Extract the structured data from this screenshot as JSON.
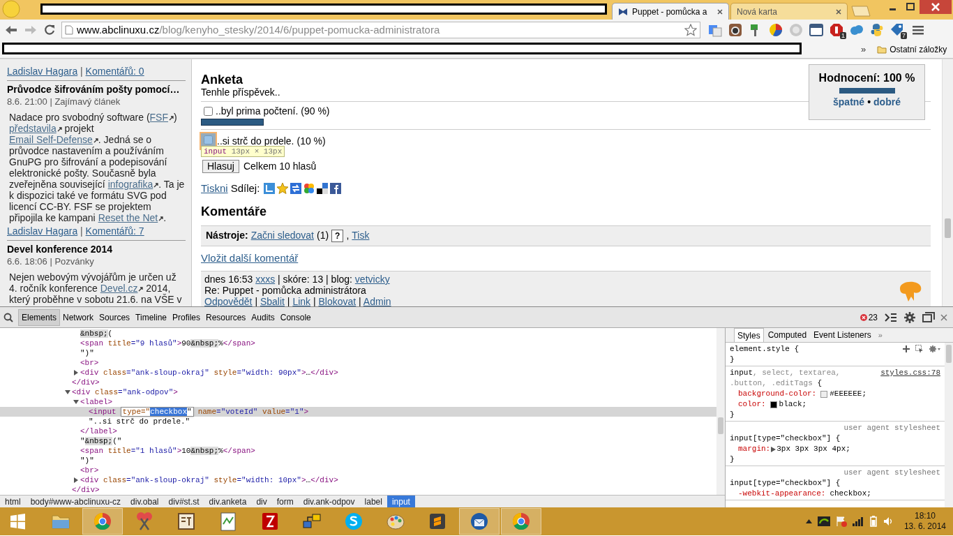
{
  "browser": {
    "tabs": [
      {
        "title": "Puppet - pomůcka a",
        "selected": true
      },
      {
        "title": "Nová karta",
        "selected": false
      }
    ],
    "url": {
      "host": "www.abclinuxu.cz",
      "path": "/blog/kenyho_stesky/2014/6/puppet-pomucka-administratora"
    },
    "extensions": [
      {
        "kind": "translate"
      },
      {
        "kind": "camera"
      },
      {
        "kind": "pin"
      },
      {
        "kind": "pie"
      },
      {
        "kind": "globe"
      },
      {
        "kind": "window"
      },
      {
        "kind": "stop",
        "badge": "1"
      },
      {
        "kind": "cloud"
      },
      {
        "kind": "python"
      },
      {
        "kind": "tag",
        "badge": "7"
      }
    ],
    "bookmarks": {
      "overflow": "»",
      "folder": "Ostatní záložky"
    }
  },
  "sidebar": {
    "top_footer": [
      {
        "text": "Ladislav Hagara",
        "link": true,
        "external": false
      },
      {
        "text": " | ",
        "link": false
      },
      {
        "text": "Komentářů: 0",
        "link": true,
        "external": false
      }
    ],
    "articles": [
      {
        "title": "Průvodce šifrováním pošty pomocí…",
        "meta": "8.6. 21:00 | Zajímavý článek",
        "body": [
          {
            "text": "Nadace pro svobodný software (",
            "link": false
          },
          {
            "text": "FSF",
            "link": true,
            "external": true
          },
          {
            "text": ") ",
            "link": false
          },
          {
            "text": "představila",
            "link": true,
            "external": true
          },
          {
            "text": " projekt ",
            "link": false
          },
          {
            "text": "Email Self-Defense",
            "link": true,
            "external": true
          },
          {
            "text": ". Jedná se o průvodce nastavením a používáním GnuPG pro šifrování a podepisování elektronické pošty. Současně byla zveřejněna související ",
            "link": false
          },
          {
            "text": "infografika",
            "link": true,
            "external": true
          },
          {
            "text": ". Ta je k dispozici také ve formátu SVG pod licencí CC-BY. FSF se projektem připojila ke kampani ",
            "link": false
          },
          {
            "text": "Reset the Net",
            "link": true,
            "external": true
          },
          {
            "text": ".",
            "link": false
          }
        ],
        "footer": [
          {
            "text": "Ladislav Hagara",
            "link": true,
            "external": false
          },
          {
            "text": " | ",
            "link": false
          },
          {
            "text": "Komentářů: 7",
            "link": true,
            "external": false
          }
        ]
      },
      {
        "title": "Devel konference 2014",
        "meta": "6.6. 18:06 | Pozvánky",
        "body": [
          {
            "text": "Nejen webovým vývojářům je určen už 4. ročník konference ",
            "link": false
          },
          {
            "text": "Devel.cz",
            "link": true,
            "external": true
          },
          {
            "text": " 2014, který proběhne v sobotu 21.6. na VŠE v",
            "link": false
          }
        ]
      }
    ]
  },
  "rating": {
    "title": "Hodnocení: 100 %",
    "level": 1,
    "bad": "špatné",
    "dot": "•",
    "good": "dobré"
  },
  "poll": {
    "title": "Anketa",
    "question": "Tenhle příspěvek..",
    "options": [
      {
        "label": "..byl prima počtení.",
        "percent": "(90 %)",
        "checked": false,
        "inspected": false,
        "level": 0.9
      },
      {
        "label": "..si strč do prdele.",
        "percent": "(10 %)",
        "checked": false,
        "inspected": true
      }
    ],
    "tooltip": {
      "tag": "input",
      "size": "13px × 13px"
    },
    "vote_button": "Hlasuj",
    "total": "Celkem 10 hlasů"
  },
  "share": {
    "print": "Tiskni",
    "label": "Sdílej:",
    "services": [
      {
        "kind": "arrow"
      },
      {
        "kind": "star"
      },
      {
        "kind": "swap"
      },
      {
        "kind": "google"
      },
      {
        "kind": "delicious"
      },
      {
        "kind": "facebook"
      }
    ]
  },
  "comments": {
    "title": "Komentáře",
    "tools_label": "Nástroje:",
    "follow": "Začni sledovat",
    "follow_count": "(1)",
    "help": "?",
    "comma": ",",
    "print": "Tisk",
    "add": "Vložit další komentář",
    "items": [
      {
        "meta": [
          {
            "text": "dnes 16:53 ",
            "link": false
          },
          {
            "text": "xxxs",
            "link": true,
            "external": false
          },
          {
            "text": " | skóre: 13 | blog: ",
            "link": false
          },
          {
            "text": "vetvicky",
            "link": true,
            "external": false
          }
        ],
        "subject": "Re: Puppet - pomůcka administrátora",
        "actions": [
          {
            "text": "Odpovědět",
            "link": true,
            "external": false
          },
          {
            "text": " | ",
            "link": false
          },
          {
            "text": "Sbalit",
            "link": true,
            "external": false
          },
          {
            "text": " | ",
            "link": false
          },
          {
            "text": "Link",
            "link": true,
            "external": false
          },
          {
            "text": " | ",
            "link": false
          },
          {
            "text": "Blokovat",
            "link": true,
            "external": false
          },
          {
            "text": " | ",
            "link": false
          },
          {
            "text": "Admin",
            "link": true,
            "external": false
          }
        ]
      }
    ]
  },
  "devtools": {
    "panels": [
      {
        "label": "Elements",
        "selected": true
      },
      {
        "label": "Network",
        "selected": false
      },
      {
        "label": "Sources",
        "selected": false
      },
      {
        "label": "Timeline",
        "selected": false
      },
      {
        "label": "Profiles",
        "selected": false
      },
      {
        "label": "Resources",
        "selected": false
      },
      {
        "label": "Audits",
        "selected": false
      },
      {
        "label": "Console",
        "selected": false
      }
    ],
    "errors": "23",
    "dom": [
      {
        "closing": "</div>",
        "children": [
          {
            "markup": "&nbsp;("
          },
          {
            "markup": "<span title=\"9 hlasů\">90&nbsp;%</span>"
          },
          {
            "markup": "\")\""
          },
          {
            "markup": "<br>"
          },
          {
            "markup": "<div class=\"ank-sloup-okraj\" style=\"width: 90px\">…</div>",
            "expanded": false
          }
        ]
      },
      {
        "markup": "<div class=\"ank-odpov\">",
        "expanded": true,
        "closing": "</div>",
        "children": [
          {
            "markup": "<label>",
            "expanded": true,
            "closing": "</label>",
            "children": [
              {
                "markup": "<input",
                "selected": true,
                "editor": {
                  "before": "type=\"",
                  "value": "checkbox",
                  "after": "\""
                },
                "after": "name=\"voteId\" value=\"1\">"
              },
              {
                "markup": "\"..si strč do prdele.\""
              }
            ]
          },
          {
            "markup": "\"&nbsp;(\""
          },
          {
            "markup": "<span title=\"1 hlasů\">10&nbsp;%</span>"
          },
          {
            "markup": "\")\""
          },
          {
            "markup": "<br>"
          },
          {
            "markup": "<div class=\"ank-sloup-okraj\" style=\"width: 10px\">…</div>",
            "expanded": false
          }
        ]
      }
    ],
    "breadcrumbs": [
      {
        "label": "html",
        "selected": false
      },
      {
        "label": "body#www-abclinuxu-cz",
        "selected": false
      },
      {
        "label": "div.obal",
        "selected": false
      },
      {
        "label": "div#st.st",
        "selected": false
      },
      {
        "label": "div.anketa",
        "selected": false
      },
      {
        "label": "div",
        "selected": false
      },
      {
        "label": "form",
        "selected": false
      },
      {
        "label": "div.ank-odpov",
        "selected": false
      },
      {
        "label": "label",
        "selected": false
      },
      {
        "label": "input",
        "selected": true
      }
    ],
    "styles": {
      "tabs": [
        {
          "label": "Styles",
          "selected": true
        },
        {
          "label": "Computed",
          "selected": false
        },
        {
          "label": "Event Listeners",
          "selected": false
        }
      ],
      "more": "»",
      "rules": [
        {
          "kind": "inline",
          "selector_lines": [
            [
              {
                "text": "element.style {",
                "dim": false
              }
            ]
          ],
          "close": "}"
        },
        {
          "kind": "author",
          "source": "styles.css:78",
          "selector_lines": [
            [
              {
                "text": "input",
                "dim": false
              },
              {
                "text": ", select, textarea,",
                "dim": true
              }
            ],
            [
              {
                "text": ".button, .editTags",
                "dim": true
              },
              {
                "text": " {",
                "dim": false
              }
            ]
          ],
          "properties": [
            {
              "name": "background-color:",
              "value": "#EEEEEE;",
              "color": "#eeeeee"
            },
            {
              "name": "color:",
              "value": "black;",
              "color": "#000000"
            }
          ],
          "close": "}"
        },
        {
          "kind": "user_agent",
          "origin": "user agent stylesheet",
          "selector_lines": [
            [
              {
                "text": "input[type=\"checkbox\"] {",
                "dim": false
              }
            ]
          ],
          "properties": [
            {
              "name": "margin:",
              "value": "3px 3px 3px 4px;",
              "expandable": true
            }
          ],
          "close": "}"
        },
        {
          "kind": "user_agent",
          "origin": "user agent stylesheet",
          "selector_lines": [
            [
              {
                "text": "input[type=\"checkbox\"] {",
                "dim": false
              }
            ]
          ],
          "properties": [
            {
              "name": "-webkit-appearance:",
              "value": "checkbox;",
              "expandable": false
            }
          ]
        }
      ]
    }
  },
  "taskbar": {
    "apps": [
      {
        "kind": "explorer",
        "running": false
      },
      {
        "kind": "chrome",
        "running": true
      },
      {
        "kind": "scissors",
        "running": false
      },
      {
        "kind": "st",
        "running": false
      },
      {
        "kind": "notepad",
        "running": false
      },
      {
        "kind": "filezilla",
        "running": false
      },
      {
        "kind": "network",
        "running": false
      },
      {
        "kind": "skype",
        "running": false
      },
      {
        "kind": "paint",
        "running": false
      },
      {
        "kind": "sublime",
        "running": false
      },
      {
        "kind": "thunderbird",
        "running": true
      },
      {
        "kind": "chrome",
        "running": true
      }
    ],
    "time": "18:10",
    "date": "13. 6. 2014"
  }
}
